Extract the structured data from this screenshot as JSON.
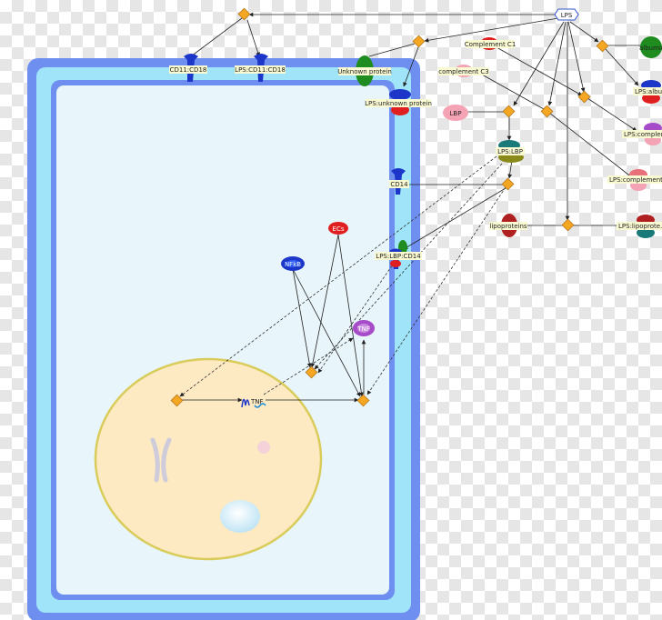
{
  "labels": {
    "lps": "LPS",
    "cd11_cd18": "CD11:CD18",
    "lps_cd11_cd18": "LPS:CD11:CD18",
    "unknown_protein": "Unknown protein",
    "lps_unknown_protein": "LPS:unknown protein",
    "complement_c1": "Complement C1",
    "complement_c3": "complement C3",
    "albumin": "albumin",
    "lps_albumin": "LPS:albu...",
    "lps_complement_c1": "LPS:complem...",
    "lps_complement_c3": "LPS:complement C...",
    "lbp": "LBP",
    "lps_lbp": "LPS:LBP",
    "cd14": "CD14",
    "lipoproteins": "lipoproteins",
    "lps_lipoproteins": "LPS:lipoprote...",
    "lps_lbp_cd14": "LPS:LBP:CD14",
    "protein_red": "ECs",
    "protein_blue": "NFkB",
    "tnf": "TNF",
    "tnf_gene": "TNF"
  },
  "colors": {
    "cell_outer": "#6f8ff0",
    "cell_mid": "#9fe4f8",
    "cell_inner": "#e8f5fa",
    "nucleus": "#fde9c2",
    "nucleus_border": "#d9cc5a",
    "process_node": "#f5a623",
    "receptor_blue": "#1b36c8"
  },
  "icons": [
    "receptor-icon",
    "protein-oval-icon",
    "process-diamond-icon",
    "chromosome-icon",
    "gene-icon"
  ]
}
